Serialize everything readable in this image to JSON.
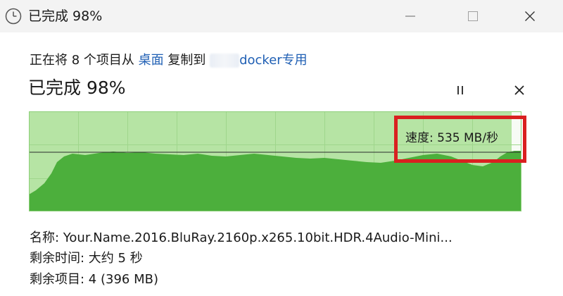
{
  "window": {
    "title": "已完成 98%"
  },
  "copy": {
    "prefix": "正在将 8 个项目从 ",
    "source": "桌面",
    "middle": " 复制到 ",
    "destination": "docker专用"
  },
  "status": {
    "heading": "已完成 98%",
    "percent_complete": 98
  },
  "speed": {
    "label": "速度: 535 MB/秒"
  },
  "details": {
    "name_label": "名称: ",
    "name_value": "Your.Name.2016.BluRay.2160p.x265.10bit.HDR.4Audio-Mini...",
    "time_label": "剩余时间: ",
    "time_value": "大约 5 秒",
    "items_label": "剩余项目: ",
    "items_value": "4 (396 MB)"
  },
  "icons": {
    "title": "clock-icon",
    "minimize": "minimize-icon",
    "maximize": "maximize-icon",
    "close": "close-icon",
    "pause": "pause-icon",
    "cancel": "cancel-icon"
  },
  "colors": {
    "progress_fill": "#b6e4a4",
    "speed_area": "#4caf3c",
    "chart_border": "#8ccf78",
    "highlight": "#d92020",
    "link": "#1f5fb4"
  }
}
